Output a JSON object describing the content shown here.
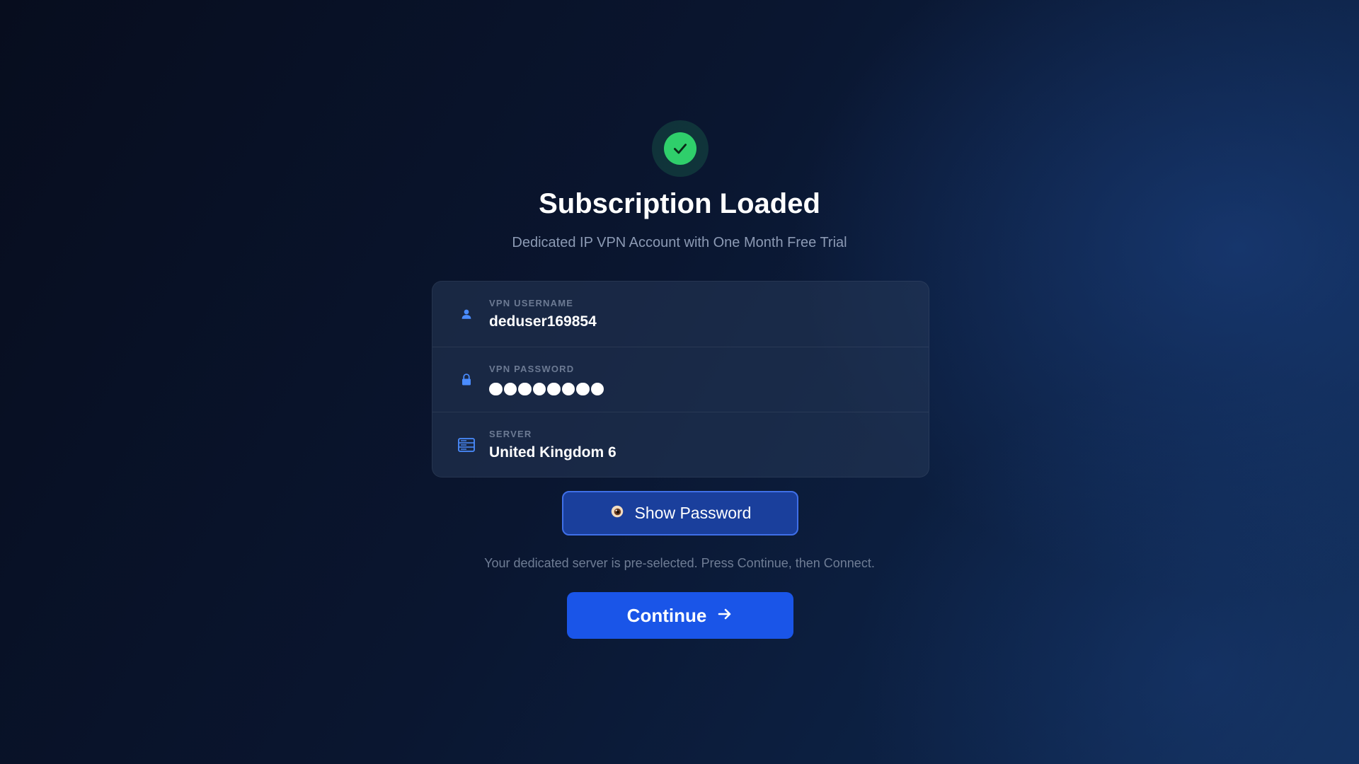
{
  "status": {
    "icon": "check-circle-icon",
    "title": "Subscription Loaded",
    "subtitle": "Dedicated IP VPN Account with One Month Free Trial"
  },
  "credentials": {
    "username": {
      "icon": "user-icon",
      "label": "VPN USERNAME",
      "value": "deduser169854"
    },
    "password": {
      "icon": "lock-icon",
      "label": "VPN PASSWORD",
      "masked_length": 8
    },
    "server": {
      "icon": "server-icon",
      "label": "SERVER",
      "value": "United Kingdom 6"
    }
  },
  "actions": {
    "show_password": {
      "icon": "eye-icon",
      "label": "Show Password"
    },
    "hint": "Your dedicated server is pre-selected. Press Continue, then Connect.",
    "continue": {
      "icon": "arrow-right-icon",
      "label": "Continue"
    }
  },
  "colors": {
    "success": "#2fcf6b",
    "primary": "#1a55e8",
    "secondary_button": "#1a3f9c",
    "accent_icon": "#4a8cff"
  }
}
